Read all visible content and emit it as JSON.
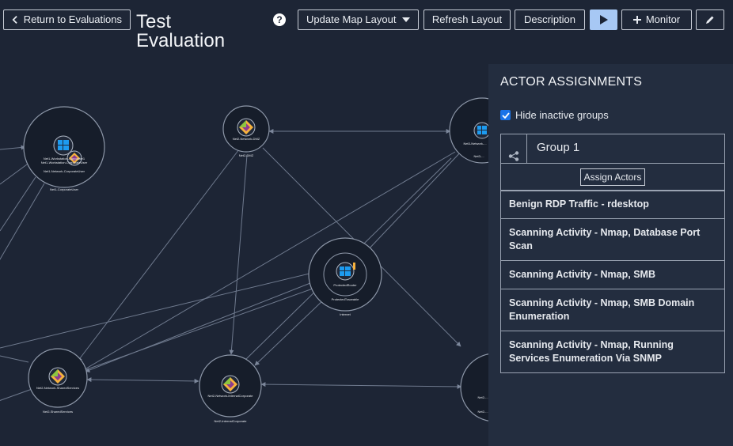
{
  "toolbar": {
    "back_label": "Return to Evaluations",
    "update_layout_label": "Update Map Layout",
    "refresh_label": "Refresh Layout",
    "description_label": "Description",
    "monitor_label": "Monitor",
    "help_glyph": "?"
  },
  "page": {
    "title_line1": "Test",
    "title_line2": "Evaluation"
  },
  "panel": {
    "title": "ACTOR ASSIGNMENTS",
    "hide_inactive_label": "Hide inactive groups",
    "hide_inactive_checked": true,
    "group": {
      "name": "Group 1",
      "assign_label": "Assign Actors"
    },
    "actors": [
      "Benign RDP Traffic - rdesktop",
      "Scanning Activity - Nmap, Database Port Scan",
      "Scanning Activity - Nmap, SMB",
      "Scanning Activity - Nmap, SMB Domain Enumeration",
      "Scanning Activity - Nmap, Running Services Enumeration Via SNMP"
    ]
  },
  "map": {
    "nodes": [
      {
        "id": "n1",
        "icons": [
          "windows-icon",
          "linux-icon"
        ],
        "labels": [
          "Net1-Workstation-Corporate1",
          "Net1-Workstation-CorporateUser",
          "Net1-Network-CorporateUser"
        ],
        "caption": "Net1-CorporateUser"
      },
      {
        "id": "n2",
        "icons": [
          "linux-icon"
        ],
        "labels": [
          "Net2-Network-DMZ"
        ],
        "caption": "Net2-DMZ"
      },
      {
        "id": "n3",
        "icons": [
          "windows-icon"
        ],
        "labels": [
          "Net3-Network-..."
        ],
        "caption": "Net3-..."
      },
      {
        "id": "n4",
        "icons": [
          "windows-icon"
        ],
        "labels": [
          "ProtectedRouter",
          "ProtectedTraceable"
        ],
        "caption": "Internet"
      },
      {
        "id": "n5",
        "icons": [
          "linux-icon"
        ],
        "labels": [
          "Net2-Network-SharedServices"
        ],
        "caption": "Net2-SharedServices"
      },
      {
        "id": "n6",
        "icons": [
          "linux-icon"
        ],
        "labels": [
          "Net2-Network-InternalCorporate"
        ],
        "caption": "Net2-InternalCorporate"
      },
      {
        "id": "n7",
        "icons": [],
        "labels": [
          "Net2-..."
        ],
        "caption": "Net2-..."
      }
    ]
  },
  "colors": {
    "background": "#1d2535",
    "panel": "#232d3f",
    "accent": "#a7c8f4",
    "edge": "#6f7a8e"
  }
}
